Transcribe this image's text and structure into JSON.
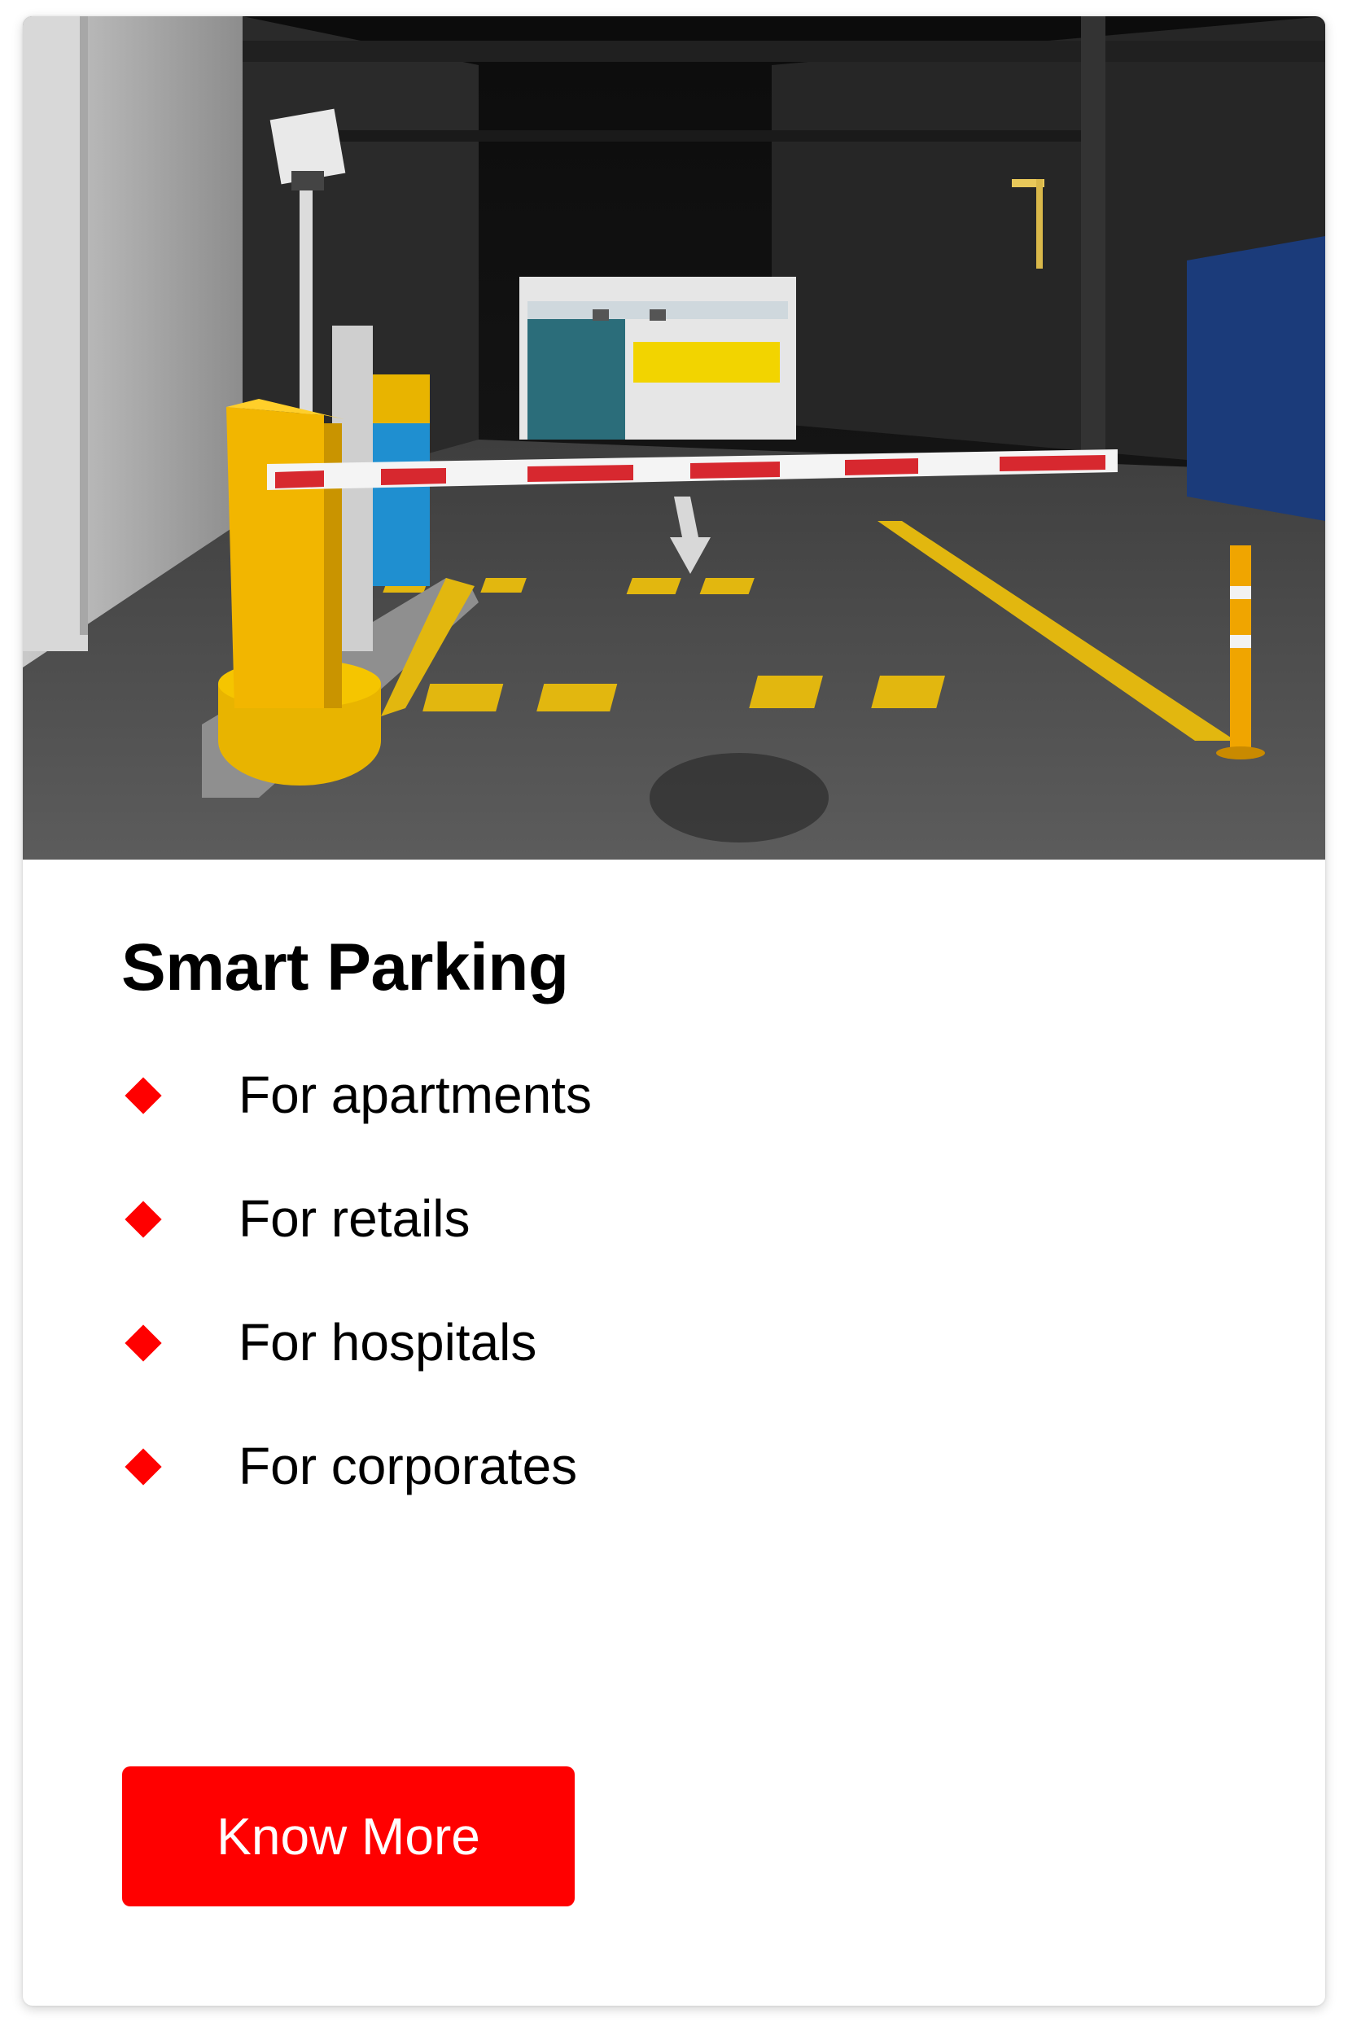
{
  "card": {
    "image_alt": "Parking garage entrance with a red and white boom barrier",
    "title": "Smart Parking",
    "features": [
      {
        "label": "For apartments"
      },
      {
        "label": "For retails"
      },
      {
        "label": "For hospitals"
      },
      {
        "label": "For corporates"
      }
    ],
    "cta_label": "Know More",
    "bullet_icon": "diamond-bullet-icon"
  },
  "colors": {
    "accent": "#ff0000",
    "card_background": "#ffffff",
    "text": "#000000",
    "button_text": "#ffffff"
  }
}
